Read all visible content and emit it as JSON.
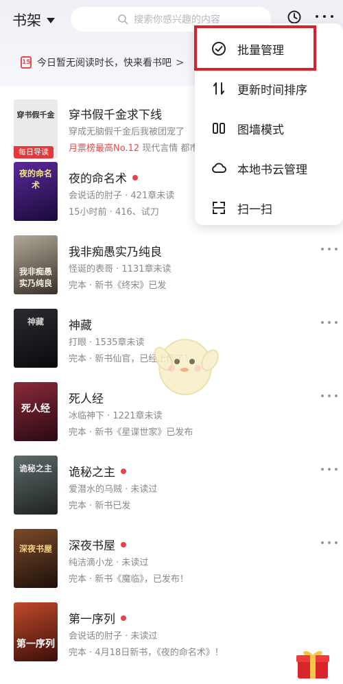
{
  "header": {
    "title": "书架",
    "search_placeholder": "搜索你感兴趣的内容"
  },
  "banner": {
    "text": "今日暂无阅读时长，快来看书吧",
    "chevron": ">"
  },
  "books": [
    {
      "title": "穿书假千金求下线",
      "line1": "穿成无脑假千金后我被团宠了",
      "line2_red": "月票榜最高No.12",
      "line2_rest": "  现代言情  都市",
      "badge": "每日导读",
      "cover_text": "穿书假千金",
      "cover_color": "#eaeaea",
      "has_dot": false
    },
    {
      "title": "夜的命名术",
      "line1": "会说话的肘子 · 421章未读",
      "line2_red": "",
      "line2_rest": "15小时前 · 416、试刀",
      "badge": "",
      "cover_text": "夜的命名术",
      "cover_color": "#3a1a6a",
      "has_dot": true
    },
    {
      "title": "我非痴愚实乃纯良",
      "line1": "怪诞的表哥 · 1131章未读",
      "line2_red": "",
      "line2_rest": "完本 · 新书《终宋》已发",
      "badge": "",
      "cover_text": "我非痴愚 实乃纯良",
      "cover_color": "#7d7468",
      "has_dot": false
    },
    {
      "title": "神藏",
      "line1": "打眼 · 1535章未读",
      "line2_red": "",
      "line2_rest": "完本 · 新书仙官，已经上传了！",
      "badge": "",
      "cover_text": "神藏",
      "cover_color": "#1e1e22",
      "has_dot": false
    },
    {
      "title": "死人经",
      "line1": "冰临神下 · 1221章未读",
      "line2_red": "",
      "line2_rest": "完本 · 新书《星谍世家》已发布",
      "badge": "",
      "cover_text": "死人经",
      "cover_color": "#5a1a22",
      "has_dot": false
    },
    {
      "title": "诡秘之主",
      "line1": "爱潜水的乌贼 · 未读过",
      "line2_red": "",
      "line2_rest": "完本 · 新书已发",
      "badge": "",
      "cover_text": "诡秘之主",
      "cover_color": "#3b3b3b",
      "has_dot": true
    },
    {
      "title": "深夜书屋",
      "line1": "纯洁滴小龙 · 未读过",
      "line2_red": "",
      "line2_rest": "完本 · 新书《魔临》，已发布！",
      "badge": "",
      "cover_text": "深夜书屋",
      "cover_color": "#4a2c1e",
      "has_dot": true
    },
    {
      "title": "第一序列",
      "line1": "会说话的肘子 · 未读过",
      "line2_red": "",
      "line2_rest": "完本 · 4月18日新书，《夜的命名术》！",
      "badge": "",
      "cover_text": "第一序列",
      "cover_color": "#8a2a1e",
      "has_dot": true
    }
  ],
  "menu": {
    "items": [
      {
        "label": "批量管理",
        "icon": "check-circle-icon"
      },
      {
        "label": "更新时间排序",
        "icon": "sort-icon"
      },
      {
        "label": "图墙模式",
        "icon": "grid-icon"
      },
      {
        "label": "本地书云管理",
        "icon": "cloud-icon"
      },
      {
        "label": "扫一扫",
        "icon": "scan-icon"
      }
    ]
  },
  "colors": {
    "accent": "#e34c4c",
    "highlight_border": "#d6232a"
  }
}
